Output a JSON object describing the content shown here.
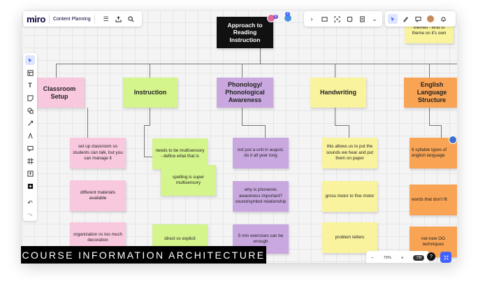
{
  "app": {
    "logo": "miro",
    "board_name": "Content Planning"
  },
  "collaborators": {
    "count_badge": "9",
    "sub_badge": "2"
  },
  "banner": "COURSE INFORMATION ARCHITECTURE",
  "zoom": {
    "level": "75%",
    "minus": "−",
    "plus": "+",
    "page": "7/8",
    "help": "?"
  },
  "root": "Approach to Reading Instruction",
  "top_right_note": "themes - kind of theme on it's own",
  "columns": [
    {
      "title": "Classroom Setup",
      "color": "pink",
      "notes": [
        "set up classroom so students can talk, but you can manage it",
        "different materials available",
        "organization vs too much decoration"
      ]
    },
    {
      "title": "Instruction",
      "color": "green",
      "notes": [
        "needs to be multisensory - define what that is",
        "spelling is super multisensory",
        "direct vs explicit"
      ]
    },
    {
      "title": "Phonology/ Phonological Awareness",
      "color": "purple",
      "notes": [
        "not just a unit in august. do it all year long",
        "why is phonemic awareness important? sound/symbol relationship",
        "5 min exercises can be enough"
      ]
    },
    {
      "title": "Handwriting",
      "color": "yellow",
      "notes": [
        "this allows us to put the sounds we hear and put them on paper",
        "gross motor to fine motor",
        "problem letters"
      ]
    },
    {
      "title": "English Language Structure",
      "color": "orange",
      "notes": [
        "6 syllable types of english language",
        "words that don't fit",
        "net-new OG techniques"
      ]
    }
  ],
  "colors": {
    "accent": "#4262ff",
    "pink": "#f8c8de",
    "green": "#d4f48c",
    "purple": "#c9a8e0",
    "yellow": "#faf39e",
    "orange": "#f9a354"
  }
}
